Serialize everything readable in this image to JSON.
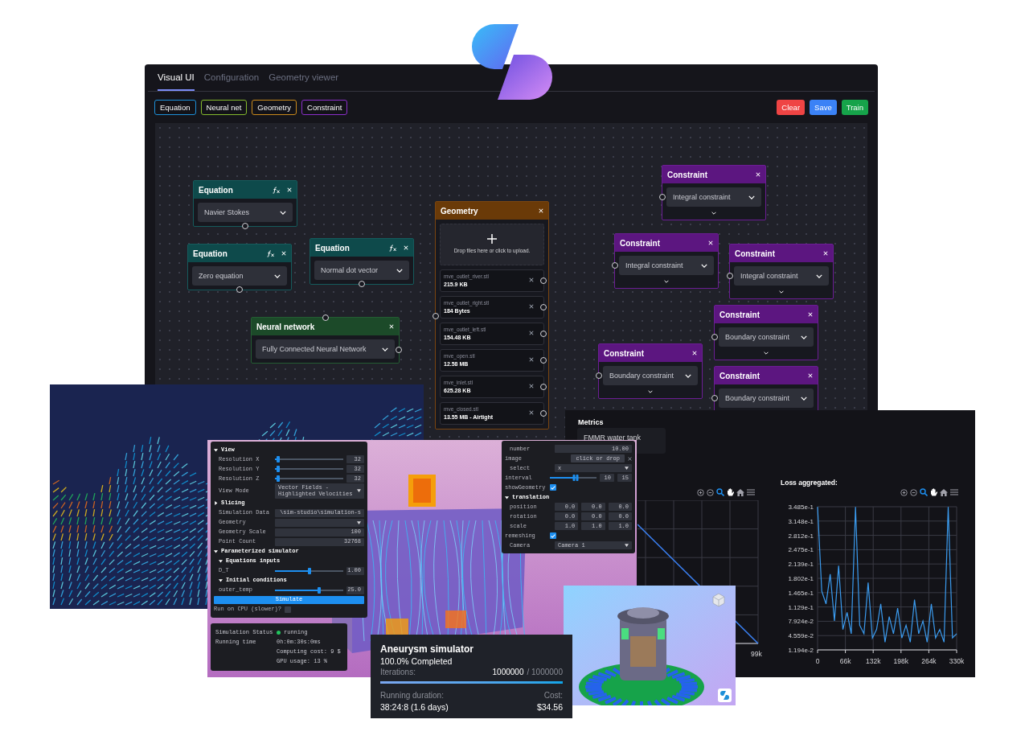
{
  "editor": {
    "tabs": [
      {
        "label": "Visual UI",
        "selected": true
      },
      {
        "label": "Configuration",
        "selected": false
      },
      {
        "label": "Geometry viewer",
        "selected": false
      }
    ],
    "palette": [
      {
        "label": "Equation",
        "color": "#1d8fd8"
      },
      {
        "label": "Neural net",
        "color": "#84b92d"
      },
      {
        "label": "Geometry",
        "color": "#c98a1c"
      },
      {
        "label": "Constraint",
        "color": "#8b2fc9"
      }
    ],
    "actions": [
      {
        "label": "Clear",
        "color": "#ef4444"
      },
      {
        "label": "Save",
        "color": "#3b82f6"
      },
      {
        "label": "Train",
        "color": "#16a34a"
      }
    ],
    "nodes": [
      {
        "kind": "equation",
        "title": "Equation",
        "value": "Navier Stokes"
      },
      {
        "kind": "equation",
        "title": "Equation",
        "value": "Zero equation"
      },
      {
        "kind": "equation",
        "title": "Equation",
        "value": "Normal dot vector"
      },
      {
        "kind": "neural_network",
        "title": "Neural network",
        "value": "Fully Connected Neural Network"
      },
      {
        "kind": "geometry",
        "title": "Geometry",
        "upload_hint": "Drop files here or click to upload.",
        "files": [
          {
            "name": "mve_outlet_river.stl",
            "size": "215.9 KB"
          },
          {
            "name": "mve_outlet_right.stl",
            "size": "184 Bytes"
          },
          {
            "name": "mve_outlet_left.stl",
            "size": "154.48 KB"
          },
          {
            "name": "mve_open.stl",
            "size": "12.58 MB"
          },
          {
            "name": "mve_inlet.stl",
            "size": "625.28 KB"
          },
          {
            "name": "mve_closed.stl",
            "size": "13.55 MB - Airtight"
          }
        ]
      },
      {
        "kind": "constraint",
        "title": "Constraint",
        "value": "Integral constraint"
      },
      {
        "kind": "constraint",
        "title": "Constraint",
        "value": "Integral constraint"
      },
      {
        "kind": "constraint",
        "title": "Constraint",
        "value": "Integral constraint"
      },
      {
        "kind": "constraint",
        "title": "Constraint",
        "value": "Boundary constraint"
      },
      {
        "kind": "constraint",
        "title": "Constraint",
        "value": "Boundary constraint"
      },
      {
        "kind": "constraint",
        "title": "Constraint",
        "value": "Boundary constraint"
      }
    ]
  },
  "simulator": {
    "controls": [
      {
        "kind": "section",
        "label": "View",
        "expanded": true
      },
      {
        "kind": "slider",
        "label": "Resolution X",
        "level": 0.05,
        "value": "32"
      },
      {
        "kind": "slider",
        "label": "Resolution Y",
        "level": 0.05,
        "value": "32"
      },
      {
        "kind": "slider",
        "label": "Resolution Z",
        "level": 0.05,
        "value": "32"
      },
      {
        "kind": "select",
        "label": "View Mode",
        "value": "Vector Fields - Highlighted Velocities"
      },
      {
        "kind": "section",
        "label": "Slicing",
        "expanded": false
      },
      {
        "kind": "input",
        "label": "Simulation Data",
        "value": "\\sim-studio\\simulation-s"
      },
      {
        "kind": "select",
        "label": "Geometry"
      },
      {
        "kind": "input",
        "label": "Geometry Scale",
        "value": "100"
      },
      {
        "kind": "input",
        "label": "Point Count",
        "value": "32768"
      },
      {
        "kind": "section",
        "label": "Parameterized simulator",
        "expanded": true
      },
      {
        "kind": "group",
        "label": "Equations inputs",
        "expanded": true
      },
      {
        "kind": "slider",
        "label": "D_T",
        "level": 0.5,
        "value": "1.00"
      },
      {
        "kind": "group",
        "label": "Initial conditions",
        "expanded": true
      },
      {
        "kind": "slider",
        "label": "outer_temp",
        "level": 0.65,
        "value": "25.0"
      },
      {
        "kind": "button",
        "label": "Simulate"
      },
      {
        "kind": "checkbox",
        "label": "Run on CPU (slower)?",
        "checked": false
      }
    ],
    "status": [
      {
        "label": "Simulation Status",
        "value": "running",
        "color": "#22c55e"
      },
      {
        "label": "Running time",
        "value": "0h:0m:30s:0ms"
      },
      {
        "value": "Computing cost: 9 $"
      },
      {
        "value": "GPU usage: 13 %"
      }
    ],
    "properties": [
      {
        "kind": "input",
        "label": "number",
        "value": "10.00"
      },
      {
        "kind": "file",
        "label": "image",
        "button": "click or drop"
      },
      {
        "kind": "select",
        "label": "select",
        "value": "x"
      },
      {
        "kind": "range",
        "label": "interval",
        "level": 0.55,
        "low": "10",
        "high": "15"
      },
      {
        "kind": "checkbox",
        "label": "showGeometry",
        "checked": true
      },
      {
        "kind": "section",
        "label": "translation",
        "expanded": true
      },
      {
        "kind": "vector",
        "label": "position",
        "values": [
          "0.0",
          "0.0",
          "0.0"
        ]
      },
      {
        "kind": "vector",
        "label": "rotation",
        "values": [
          "0.0",
          "0.0",
          "0.0"
        ]
      },
      {
        "kind": "vector",
        "label": "scale",
        "values": [
          "1.0",
          "1.0",
          "1.0"
        ]
      },
      {
        "kind": "checkbox",
        "label": "remeshing",
        "checked": true
      },
      {
        "kind": "select",
        "label": "Camera",
        "value": "Camera 1"
      }
    ]
  },
  "progress": {
    "title": "Aneurysm simulator",
    "completed": "100.0% Completed",
    "iterations_label": "Iterations:",
    "iterations_done": "1000000",
    "iterations_total": "/ 1000000",
    "level": 1,
    "duration_label": "Running duration:",
    "duration": "38:24:8 (1.6 days)",
    "cost_label": "Cost:",
    "cost": "$34.56"
  },
  "metrics": {
    "title": "Metrics",
    "dataset": "FMMR water tank",
    "partial_chart": {
      "xtick_label": "99k"
    },
    "loss_chart": {
      "title": "Loss aggregated:",
      "chart_data": {
        "type": "line",
        "grid": true,
        "x": [
          0,
          10000,
          20000,
          30000,
          40000,
          50000,
          60000,
          70000,
          80000,
          90000,
          100000,
          110000,
          120000,
          130000,
          140000,
          150000,
          160000,
          170000,
          180000,
          190000,
          200000,
          210000,
          220000,
          230000,
          240000,
          250000,
          260000,
          270000,
          280000,
          290000,
          300000,
          310000,
          320000,
          330000
        ],
        "series": [
          {
            "color": "#3b9cf0",
            "values": [
              0.348,
              0.15,
              0.12,
              0.19,
              0.08,
              0.21,
              0.06,
              0.1,
              0.05,
              0.348,
              0.07,
              0.05,
              0.17,
              0.04,
              0.06,
              0.12,
              0.03,
              0.09,
              0.05,
              0.11,
              0.04,
              0.07,
              0.03,
              0.13,
              0.05,
              0.08,
              0.03,
              0.12,
              0.04,
              0.06,
              0.03,
              0.348,
              0.04,
              0.05
            ]
          }
        ],
        "xlim": [
          0,
          330000
        ],
        "ylim": [
          0.01194,
          0.3485
        ],
        "xticks": [
          {
            "value": 0,
            "label": "0"
          },
          {
            "value": 66000,
            "label": "66k"
          },
          {
            "value": 132000,
            "label": "132k"
          },
          {
            "value": 198000,
            "label": "198k"
          },
          {
            "value": 264000,
            "label": "264k"
          },
          {
            "value": 330000,
            "label": "330k"
          }
        ],
        "yticks": [
          {
            "value": 0.01194,
            "label": "1.194e-2"
          },
          {
            "value": 0.04559,
            "label": "4.559e-2"
          },
          {
            "value": 0.07924,
            "label": "7.924e-2"
          },
          {
            "value": 0.1129,
            "label": "1.129e-1"
          },
          {
            "value": 0.1465,
            "label": "1.465e-1"
          },
          {
            "value": 0.1802,
            "label": "1.802e-1"
          },
          {
            "value": 0.2139,
            "label": "2.139e-1"
          },
          {
            "value": 0.2475,
            "label": "2.475e-1"
          },
          {
            "value": 0.2812,
            "label": "2.812e-1"
          },
          {
            "value": 0.3148,
            "label": "3.148e-1"
          },
          {
            "value": 0.3485,
            "label": "3.485e-1"
          }
        ]
      }
    }
  }
}
